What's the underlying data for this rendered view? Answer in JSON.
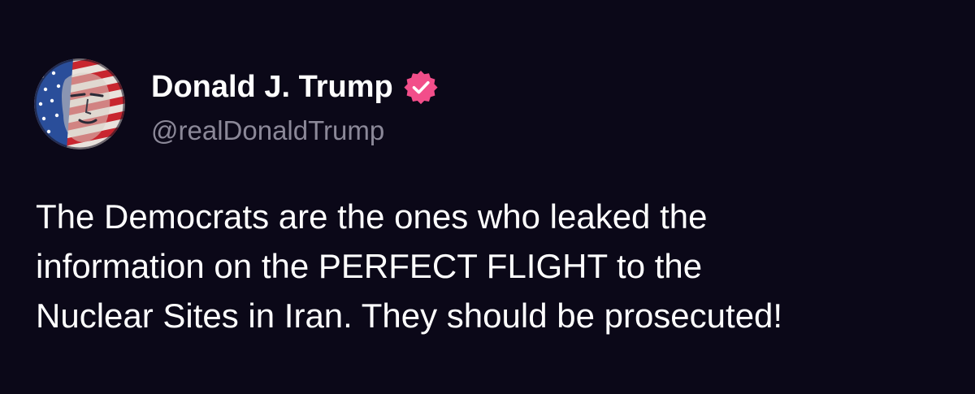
{
  "author": {
    "display_name": "Donald J. Trump",
    "handle": "@realDonaldTrump",
    "verified": true,
    "verified_color": "#f24e8a"
  },
  "post": {
    "lines": [
      "The Democrats are the ones who leaked the",
      "information on the PERFECT FLIGHT to the",
      "Nuclear Sites in Iran. They should be prosecuted!"
    ]
  },
  "theme": {
    "background": "#0b0818",
    "text": "#ffffff",
    "muted": "#8b8898"
  },
  "icons": {
    "avatar": "flag-portrait-avatar",
    "verified": "verified-badge-icon"
  }
}
